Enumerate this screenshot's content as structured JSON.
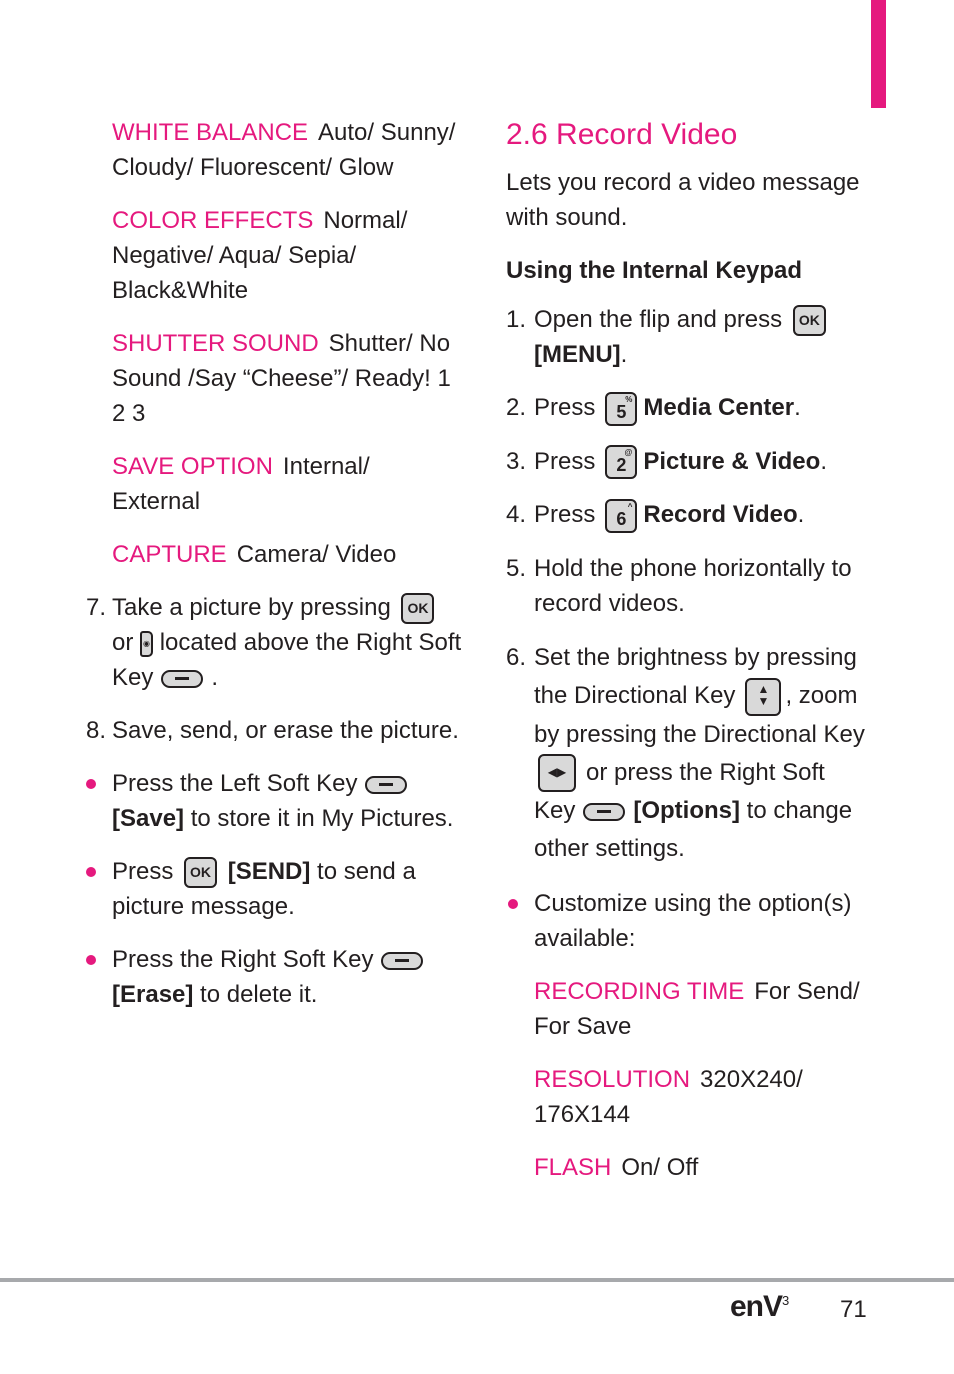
{
  "accent_color": "#e5197e",
  "left_column": {
    "options": [
      {
        "label": "WHITE BALANCE",
        "value": "Auto/ Sunny/ Cloudy/ Fluorescent/ Glow"
      },
      {
        "label": "COLOR EFFECTS",
        "value": "Normal/ Negative/ Aqua/ Sepia/ Black&White"
      },
      {
        "label": "SHUTTER SOUND",
        "value": "Shutter/ No Sound /Say “Cheese”/ Ready! 1 2 3"
      },
      {
        "label": "SAVE OPTION",
        "value": "Internal/ External"
      },
      {
        "label": "CAPTURE",
        "value": "Camera/ Video"
      }
    ],
    "step7": {
      "num": "7.",
      "part1": "Take a picture by pressing",
      "ok_key": "OK",
      "part2": "or",
      "part3": "located above the Right Soft Key",
      "part4": "."
    },
    "step8": {
      "num": "8.",
      "text": "Save, send, or erase the picture."
    },
    "bullets": [
      {
        "pre": "Press the Left Soft Key",
        "bold": "[Save]",
        "post": "to store it in My Pictures."
      },
      {
        "pre": "Press",
        "key": "OK",
        "bold": "[SEND]",
        "post": "to send a picture message."
      },
      {
        "pre": "Press the Right Soft Key",
        "bold": "[Erase]",
        "post": "to delete it."
      }
    ]
  },
  "right_column": {
    "title": "2.6 Record Video",
    "intro": "Lets you record a video message with sound.",
    "subheading": "Using the Internal Keypad",
    "steps": [
      {
        "num": "1.",
        "pre": "Open the flip and press",
        "key": "OK",
        "bold": "[MENU]",
        "post": "."
      },
      {
        "num": "2.",
        "pre": "Press",
        "key": "5",
        "key_sup": "%",
        "bold": "Media Center",
        "post": "."
      },
      {
        "num": "3.",
        "pre": "Press",
        "key": "2",
        "key_sup": "@",
        "bold": "Picture & Video",
        "post": "."
      },
      {
        "num": "4.",
        "pre": "Press",
        "key": "6",
        "key_sup": "^",
        "bold": "Record Video",
        "post": "."
      },
      {
        "num": "5.",
        "text": "Hold the phone horizontally to record videos."
      },
      {
        "num": "6.",
        "part1": "Set the brightness by pressing the Directional Key",
        "part2": ", zoom by pressing the Directional Key",
        "part3": "or press the Right Soft Key",
        "bold": "[Options]",
        "part4": "to change other settings."
      }
    ],
    "bullet": "Customize using the option(s) available:",
    "options": [
      {
        "label": "RECORDING TIME",
        "value": "For Send/ For Save"
      },
      {
        "label": "RESOLUTION",
        "value": "320X240/ 176X144"
      },
      {
        "label": "FLASH",
        "value": "On/ Off"
      }
    ]
  },
  "footer": {
    "brand": "enV",
    "brand_sup": "3",
    "page_number": "71"
  }
}
